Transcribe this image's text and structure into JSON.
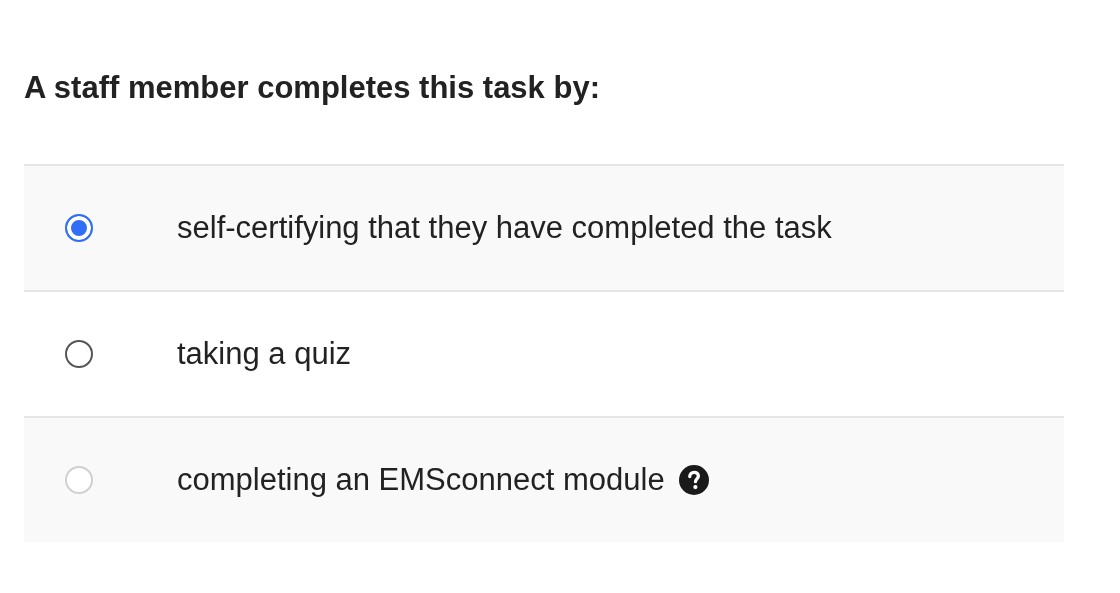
{
  "heading": "A staff member completes this task by:",
  "options": [
    {
      "label": "self-certifying that they have completed the task",
      "selected": true,
      "disabled": false,
      "help": false
    },
    {
      "label": "taking a quiz",
      "selected": false,
      "disabled": false,
      "help": false
    },
    {
      "label": "completing an EMSconnect module",
      "selected": false,
      "disabled": true,
      "help": true
    }
  ]
}
